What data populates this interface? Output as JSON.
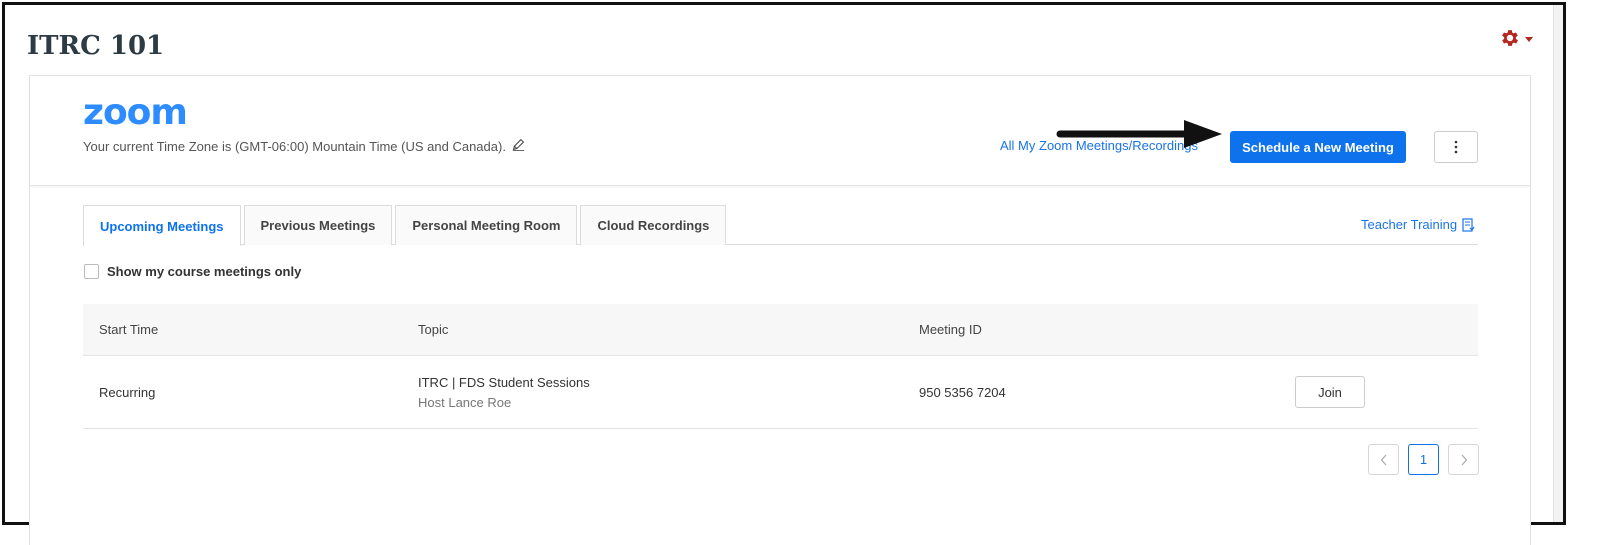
{
  "course": {
    "title": "ITRC 101"
  },
  "settings": {
    "icon": "gear-icon",
    "menu_icon": "caret-down-icon",
    "color": "#b3271f"
  },
  "zoom": {
    "logo_text": "zoom",
    "timezone_text": "Your current Time Zone is (GMT-06:00) Mountain Time (US and Canada).",
    "all_meetings_link": "All My Zoom Meetings/Recordings",
    "schedule_button": "Schedule a New Meeting",
    "more_icon": "vertical-ellipsis-icon",
    "accent_color": "#0e72ed"
  },
  "tabs": [
    {
      "label": "Upcoming Meetings",
      "active": true
    },
    {
      "label": "Previous Meetings",
      "active": false
    },
    {
      "label": "Personal Meeting Room",
      "active": false
    },
    {
      "label": "Cloud Recordings",
      "active": false
    }
  ],
  "teacher_training": {
    "label": "Teacher Training",
    "icon": "document-icon"
  },
  "filter": {
    "label": "Show my course meetings only",
    "checked": false
  },
  "table": {
    "headers": [
      "Start Time",
      "Topic",
      "Meeting ID",
      ""
    ],
    "rows": [
      {
        "start_time": "Recurring",
        "topic": "ITRC | FDS Student Sessions",
        "host": "Host Lance Roe",
        "meeting_id": "950 5356 7204",
        "action": "Join"
      }
    ]
  },
  "pagination": {
    "prev": "<",
    "current": "1",
    "next": ">"
  }
}
